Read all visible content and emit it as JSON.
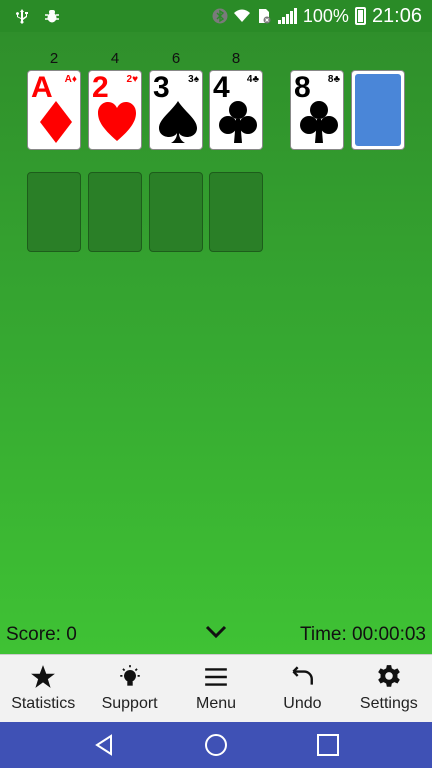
{
  "status_bar": {
    "icons_left": [
      "usb-icon",
      "bug-icon"
    ],
    "icons_right": [
      "bluetooth-icon",
      "wifi-icon",
      "sim-icon",
      "signal-icon",
      "battery-icon"
    ],
    "battery": "100%",
    "time": "21:06"
  },
  "foundations": [
    {
      "count": "2",
      "rank": "A",
      "suit": "diamond",
      "color": "#ff0000"
    },
    {
      "count": "4",
      "rank": "2",
      "suit": "heart",
      "color": "#ff0000"
    },
    {
      "count": "6",
      "rank": "3",
      "suit": "spade",
      "color": "#000000"
    },
    {
      "count": "8",
      "rank": "4",
      "suit": "club",
      "color": "#000000"
    }
  ],
  "waste_card": {
    "rank": "8",
    "suit": "club",
    "color": "#000000"
  },
  "stock": {
    "back_color": "#4a86d8"
  },
  "score_label": "Score: 0",
  "time_label": "Time: 00:00:03",
  "toolbar": {
    "statistics": "Statistics",
    "support": "Support",
    "menu": "Menu",
    "undo": "Undo",
    "settings": "Settings"
  },
  "colors": {
    "felt": "#36a831",
    "navbar": "#3f51b5",
    "toolbar": "#f2f2f2"
  }
}
